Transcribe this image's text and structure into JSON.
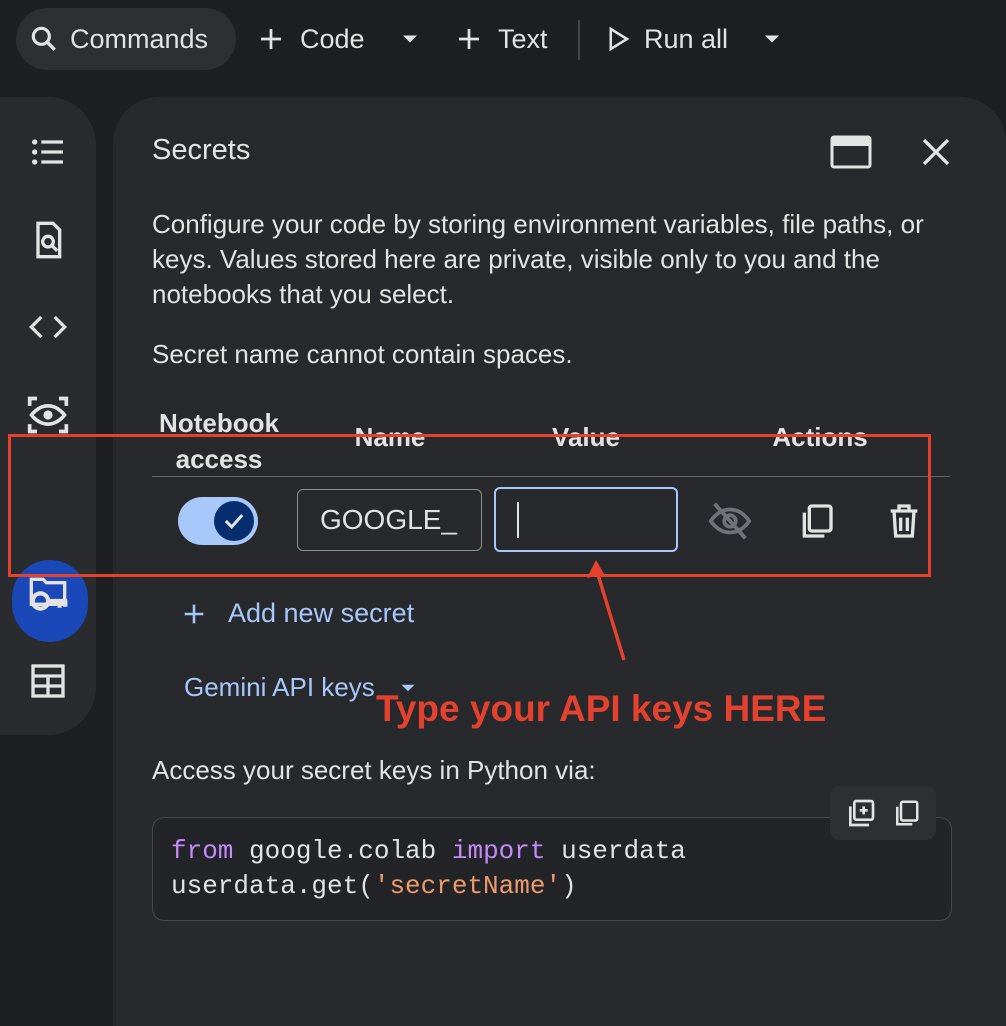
{
  "toolbar": {
    "commands_label": "Commands",
    "code_label": "Code",
    "text_label": "Text",
    "run_all_label": "Run all"
  },
  "panel": {
    "title": "Secrets",
    "description": "Configure your code by storing environment variables, file paths, or keys. Values stored here are private, visible only to you and the notebooks that you select.",
    "note": "Secret name cannot contain spaces."
  },
  "table": {
    "headers": {
      "notebook_access": "Notebook access",
      "name": "Name",
      "value": "Value",
      "actions": "Actions"
    },
    "row": {
      "access_enabled": true,
      "name_value": "GOOGLE_",
      "value_value": ""
    }
  },
  "add_secret_label": "Add new secret",
  "gemini_label": "Gemini API keys",
  "access_label": "Access your secret keys in Python via:",
  "code": {
    "line1_kw1": "from",
    "line1_mod": " google.colab ",
    "line1_kw2": "import",
    "line1_name": " userdata",
    "line2_pre": "userdata.get(",
    "line2_str": "'secretName'",
    "line2_post": ")"
  },
  "annotation": {
    "text": "Type your API keys HERE",
    "color": "#e4412f"
  },
  "colors": {
    "accent": "#a8c7fa",
    "active_rail": "#1a48b8",
    "background": "#1e1f22",
    "panel": "#28292d"
  }
}
